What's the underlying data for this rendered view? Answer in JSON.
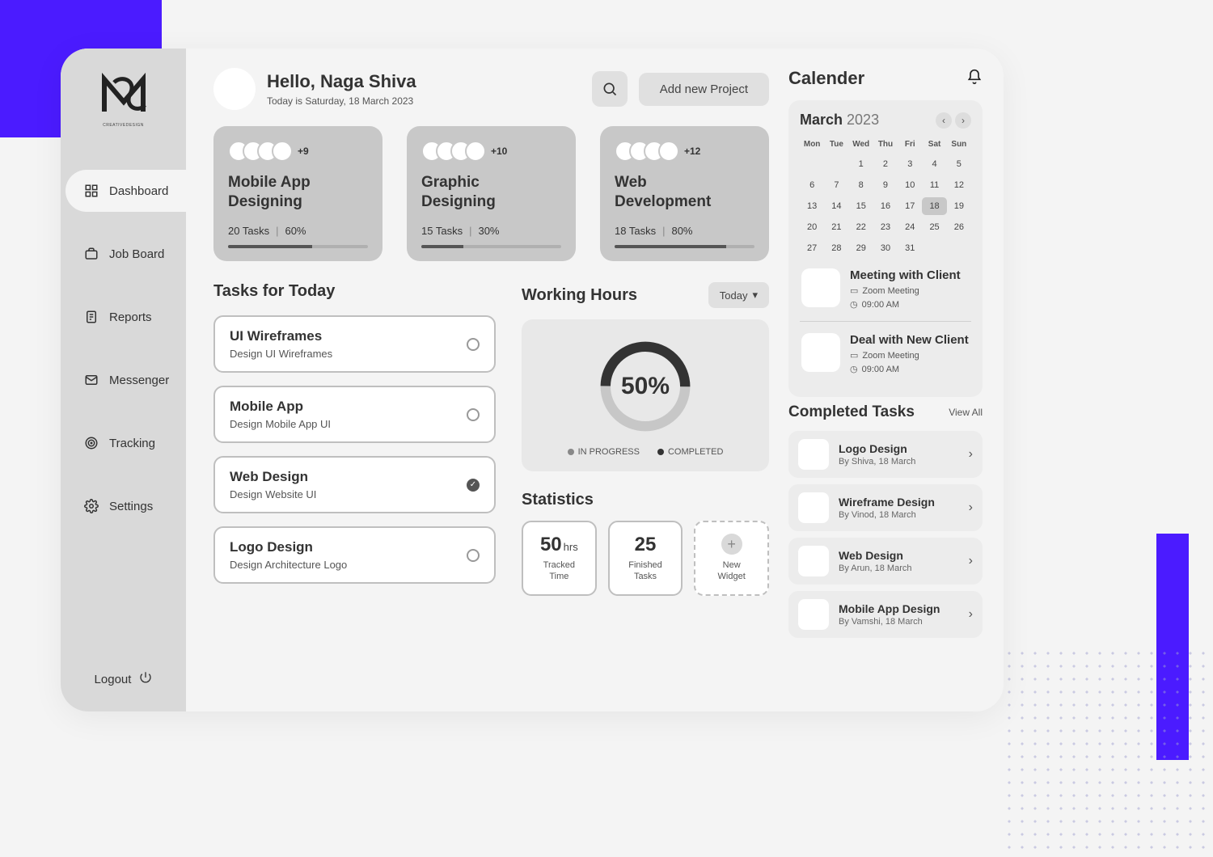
{
  "header": {
    "greeting": "Hello, Naga Shiva",
    "date_line": "Today is Saturday, 18 March 2023",
    "add_project_label": "Add new Project"
  },
  "sidebar": {
    "logo_sub": "CREATIVEDESIGN",
    "items": [
      {
        "label": "Dashboard",
        "icon": "grid",
        "active": true
      },
      {
        "label": "Job Board",
        "icon": "briefcase",
        "active": false
      },
      {
        "label": "Reports",
        "icon": "report",
        "active": false
      },
      {
        "label": "Messenger",
        "icon": "mail",
        "active": false
      },
      {
        "label": "Tracking",
        "icon": "target",
        "active": false
      },
      {
        "label": "Settings",
        "icon": "gear",
        "active": false
      }
    ],
    "logout_label": "Logout"
  },
  "projects": [
    {
      "title_l1": "Mobile App",
      "title_l2": "Designing",
      "tasks": "20 Tasks",
      "pct": "60%",
      "pct_num": 60,
      "more": "+9"
    },
    {
      "title_l1": "Graphic",
      "title_l2": "Designing",
      "tasks": "15 Tasks",
      "pct": "30%",
      "pct_num": 30,
      "more": "+10"
    },
    {
      "title_l1": "Web",
      "title_l2": "Development",
      "tasks": "18 Tasks",
      "pct": "80%",
      "pct_num": 80,
      "more": "+12"
    }
  ],
  "tasks_today": {
    "title": "Tasks  for Today",
    "items": [
      {
        "title": "UI Wireframes",
        "sub": "Design UI Wireframes",
        "done": false
      },
      {
        "title": "Mobile App",
        "sub": "Design Mobile App UI",
        "done": false
      },
      {
        "title": "Web Design",
        "sub": "Design Website UI",
        "done": true
      },
      {
        "title": "Logo Design",
        "sub": "Design Architecture Logo",
        "done": false
      }
    ]
  },
  "working_hours": {
    "title": "Working Hours",
    "selector": "Today",
    "percent_label": "50%",
    "percent_num": 50,
    "legend_in_progress": "IN PROGRESS",
    "legend_completed": "COMPLETED"
  },
  "statistics": {
    "title": "Statistics",
    "items": [
      {
        "num": "50",
        "unit": "hrs",
        "label_l1": "Tracked",
        "label_l2": "Time"
      },
      {
        "num": "25",
        "unit": "",
        "label_l1": "Finished",
        "label_l2": "Tasks"
      }
    ],
    "new_widget_label_l1": "New",
    "new_widget_label_l2": "Widget"
  },
  "calendar": {
    "title": "Calender",
    "month": "March",
    "year": "2023",
    "day_headers": [
      "Mon",
      "Tue",
      "Wed",
      "Thu",
      "Fri",
      "Sat",
      "Sun"
    ],
    "today": 18,
    "start_blank": 2,
    "days_in_month": 31
  },
  "events": [
    {
      "title": "Meeting with Client",
      "via": "Zoom Meeting",
      "time": "09:00 AM"
    },
    {
      "title": "Deal with New Client",
      "via": "Zoom Meeting",
      "time": "09:00 AM"
    }
  ],
  "completed_tasks": {
    "title": "Completed Tasks",
    "view_all": "View All",
    "items": [
      {
        "title": "Logo Design",
        "sub": "By Shiva, 18 March"
      },
      {
        "title": "Wireframe Design",
        "sub": "By Vinod, 18 March"
      },
      {
        "title": "Web Design",
        "sub": "By Arun, 18 March"
      },
      {
        "title": "Mobile App Design",
        "sub": "By Vamshi, 18 March"
      }
    ]
  },
  "chart_data": {
    "type": "pie",
    "title": "Working Hours",
    "series": [
      {
        "name": "COMPLETED",
        "value": 50
      },
      {
        "name": "IN PROGRESS",
        "value": 50
      }
    ],
    "center_label": "50%"
  }
}
